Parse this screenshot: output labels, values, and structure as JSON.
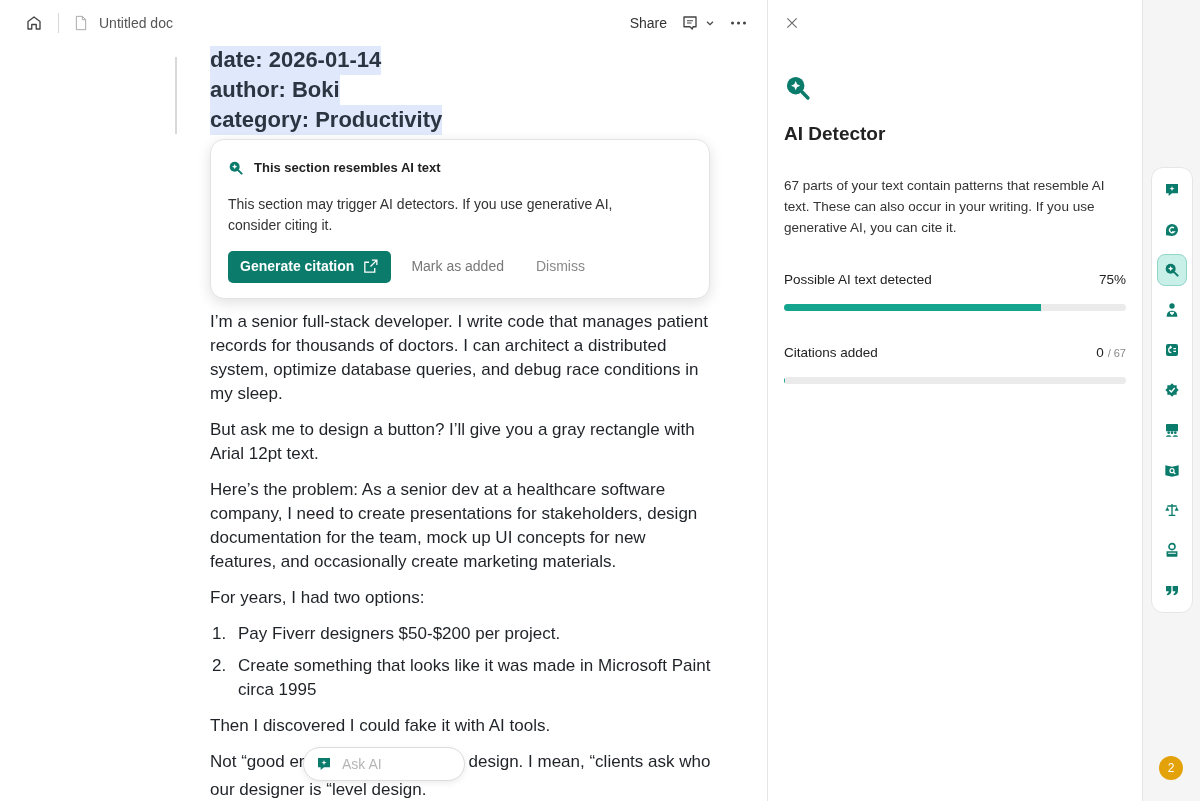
{
  "header": {
    "doc_title": "Untitled doc",
    "share": "Share"
  },
  "document": {
    "front_matter": [
      "date: 2026-01-14",
      "author: Boki",
      "category: Productivity"
    ],
    "popup": {
      "title": "This section resembles AI text",
      "body": "This section may trigger AI detectors. If you use generative AI, consider citing it.",
      "primary": "Generate citation",
      "secondary": "Mark as added",
      "dismiss": "Dismiss"
    },
    "blocks": [
      {
        "kind": "paragraph",
        "text": "I’m a senior full-stack developer. I write code that manages patient records for thousands of doctors. I can architect a distributed system, optimize database queries, and debug race conditions in my sleep."
      },
      {
        "kind": "paragraph",
        "text": "But ask me to design a button? I’ll give you a gray rectangle with Arial 12pt text."
      },
      {
        "kind": "paragraph",
        "text": "Here’s the problem: As a senior dev at a healthcare software company, I need to create presentations for stakeholders, design documentation for the team, mock up UI concepts for new features, and occasionally create marketing materials."
      },
      {
        "kind": "paragraph",
        "text": "For years, I had two options:"
      },
      {
        "kind": "list",
        "items": [
          {
            "number": "1.",
            "text": "Pay Fiverr designers $50-$200 per project."
          },
          {
            "number": "2.",
            "text": "Create something that looks like it was made in Microsoft Paint circa 1995"
          }
        ]
      },
      {
        "kind": "paragraph",
        "text": "Then I discovered I could fake it with AI tools."
      }
    ],
    "last_line_left": "Not “good er",
    "last_line_right": "design. I mean, “clients ask who",
    "cut_line": "our designer is “level design.",
    "ask_ai": {
      "placeholder": "Ask AI"
    }
  },
  "panel": {
    "title": "AI Detector",
    "description": "67 parts of your text contain patterns that resemble AI text. These can also occur in your writing. If you use generative AI, you can cite it.",
    "meters": [
      {
        "label": "Possible AI text detected",
        "value": "75%",
        "level": 0.75
      },
      {
        "label": "Citations added",
        "value": "0",
        "total": "/ 67",
        "level": 0
      }
    ]
  },
  "rail": {
    "items": [
      {
        "selected": false
      },
      {
        "selected": false
      },
      {
        "selected": true
      },
      {
        "selected": false
      },
      {
        "selected": false
      },
      {
        "selected": false
      },
      {
        "selected": false
      },
      {
        "selected": false
      },
      {
        "selected": false
      },
      {
        "selected": false
      },
      {
        "selected": false
      }
    ],
    "badge": "2"
  }
}
